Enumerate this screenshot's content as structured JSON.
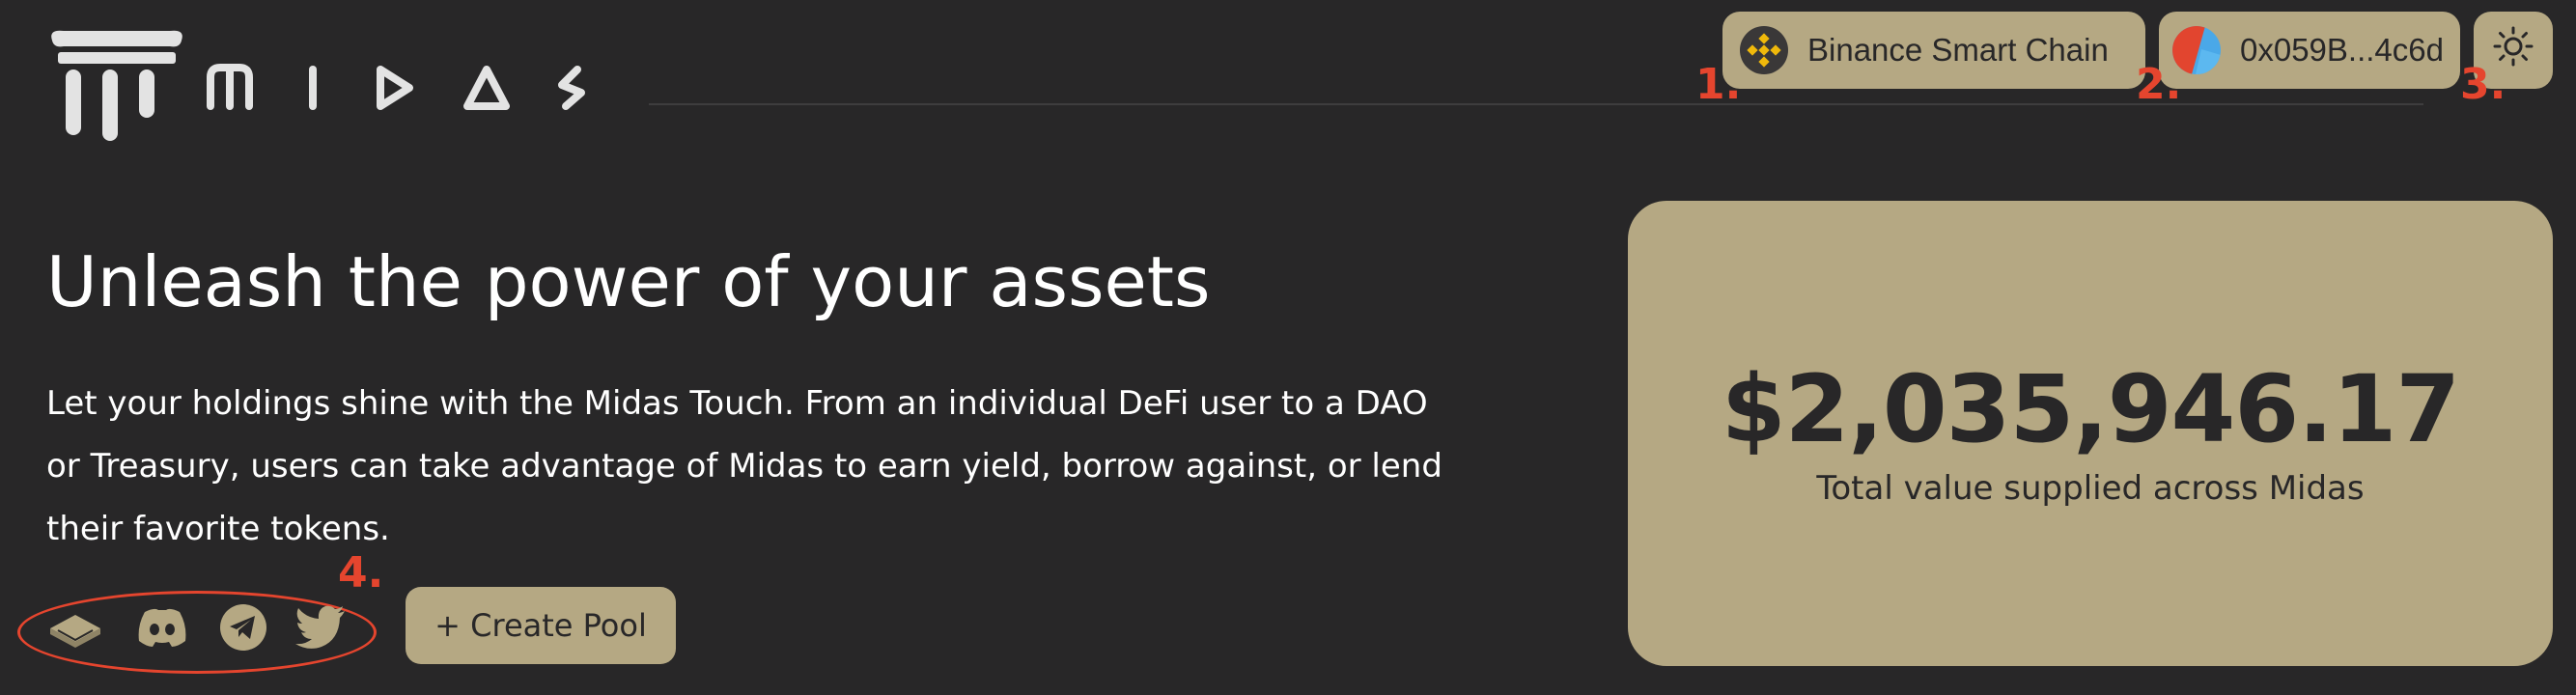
{
  "brand": {
    "name": "MIDAS",
    "logo_icon": "column-logo-icon"
  },
  "header": {
    "chain_label": "Binance Smart Chain",
    "chain_icon": "bnb-icon",
    "wallet_label": "0x059B...4c6d",
    "wallet_icon": "wallet-avatar-icon",
    "theme_icon": "sun-icon"
  },
  "markers": {
    "m1": "1.",
    "m2": "2.",
    "m3": "3.",
    "m4": "4."
  },
  "hero": {
    "headline": "Unleash the power of your assets",
    "lead": "Let your holdings shine with the Midas Touch. From an individual DeFi user to a DAO or Treasury, users can take advantage of Midas to earn yield, borrow against, or lend their favorite tokens."
  },
  "socials": [
    "docs-book-icon",
    "discord-icon",
    "telegram-icon",
    "twitter-icon"
  ],
  "actions": {
    "create_pool_label": "+ Create Pool"
  },
  "stats": {
    "total_value": "$2,035,946.17",
    "total_value_label": "Total value supplied across Midas"
  },
  "colors": {
    "background": "#282728",
    "accent": "#b5a883",
    "annotation": "#e5452e",
    "bnb": "#f0b90b"
  }
}
